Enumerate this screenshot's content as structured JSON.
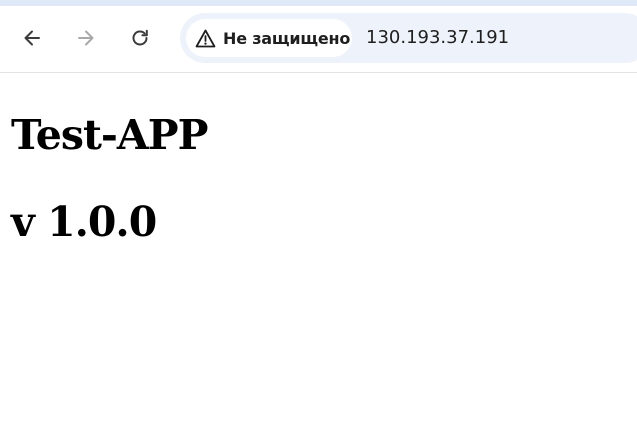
{
  "browser": {
    "security": {
      "label": "Не защищено",
      "icon": "warning-icon"
    },
    "address": {
      "url": "130.193.37.191"
    },
    "nav": {
      "back_icon": "arrow-left-icon",
      "forward_icon": "arrow-right-icon",
      "reload_icon": "reload-icon"
    },
    "colors": {
      "tab_strip": "#dfe9f8",
      "omnibox_bg": "#eef2fa",
      "chip_bg": "#ffffff",
      "icon_active": "#3c3c3c",
      "icon_disabled": "#a9a9a9"
    }
  },
  "page": {
    "title": "Test-APP",
    "version": "v 1.0.0"
  }
}
